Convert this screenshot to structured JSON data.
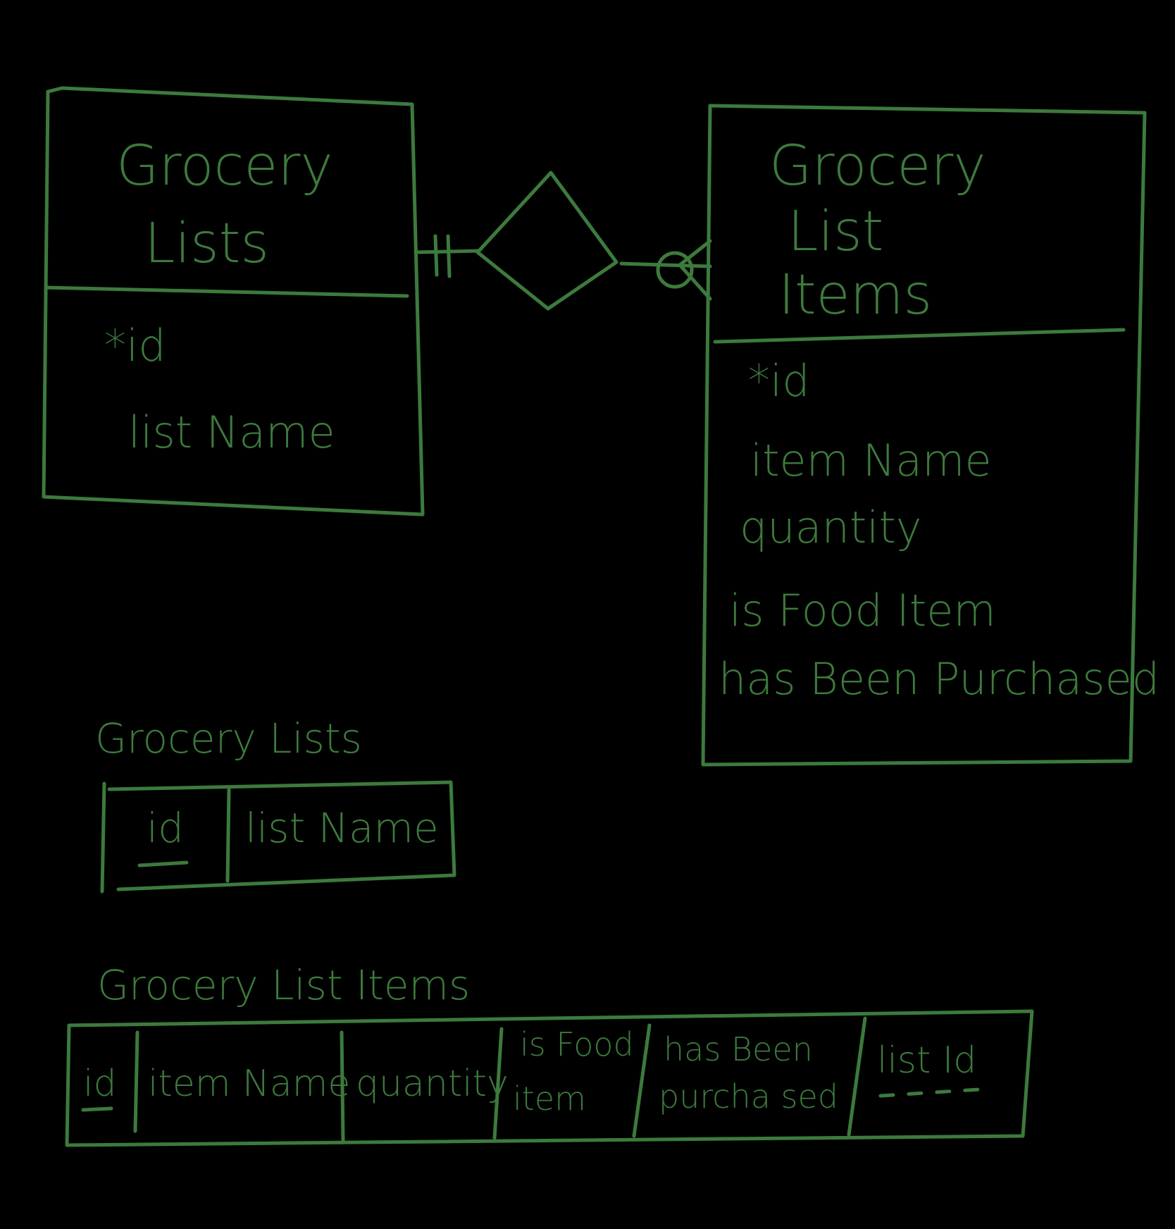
{
  "diagram": {
    "ink_color": "#3d7a3d",
    "background": "#000000",
    "entities": [
      {
        "title_lines": [
          "Grocery",
          "Lists"
        ],
        "attributes": [
          "*id",
          "list Name"
        ]
      },
      {
        "title_lines": [
          "Grocery",
          "List",
          "Items"
        ],
        "attributes": [
          "*id",
          "item Name",
          "quantity",
          "is Food Item",
          "has Been Purchased"
        ]
      }
    ],
    "relationship": {
      "left_cardinality": "one-and-only-one",
      "right_cardinality": "zero-or-many"
    },
    "tables": [
      {
        "name": "Grocery Lists",
        "columns": [
          "id",
          "list Name"
        ]
      },
      {
        "name": "Grocery List Items",
        "columns": [
          {
            "lines": [
              "id"
            ]
          },
          {
            "lines": [
              "item Name"
            ]
          },
          {
            "lines": [
              "quantity"
            ]
          },
          {
            "lines": [
              "is Food",
              "item"
            ]
          },
          {
            "lines": [
              "has Been",
              "purcha sed"
            ]
          },
          {
            "lines": [
              "list Id"
            ]
          }
        ]
      }
    ]
  }
}
